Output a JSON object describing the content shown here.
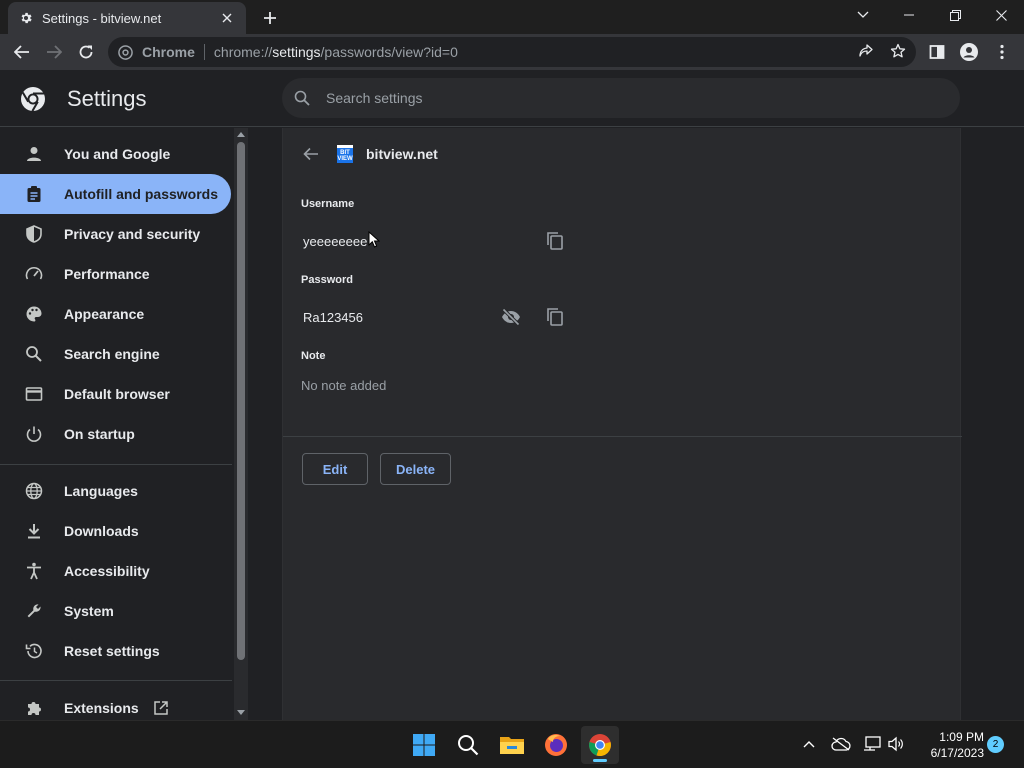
{
  "tab": {
    "title": "Settings - bitview.net",
    "icon": "gear-icon"
  },
  "omnibox": {
    "site_label": "Chrome",
    "url_prefix": "chrome://",
    "url_host": "settings",
    "url_path": "/passwords/view?id=0"
  },
  "header": {
    "title": "Settings",
    "search_placeholder": "Search settings"
  },
  "sidebar": {
    "items": [
      {
        "label": "You and Google",
        "icon": "person-icon"
      },
      {
        "label": "Autofill and passwords",
        "icon": "clipboard-icon",
        "active": true
      },
      {
        "label": "Privacy and security",
        "icon": "shield-icon"
      },
      {
        "label": "Performance",
        "icon": "speedometer-icon"
      },
      {
        "label": "Appearance",
        "icon": "palette-icon"
      },
      {
        "label": "Search engine",
        "icon": "search-icon"
      },
      {
        "label": "Default browser",
        "icon": "browser-icon"
      },
      {
        "label": "On startup",
        "icon": "power-icon"
      },
      {
        "label": "Languages",
        "icon": "globe-icon"
      },
      {
        "label": "Downloads",
        "icon": "download-icon"
      },
      {
        "label": "Accessibility",
        "icon": "accessibility-icon"
      },
      {
        "label": "System",
        "icon": "wrench-icon"
      },
      {
        "label": "Reset settings",
        "icon": "history-icon"
      },
      {
        "label": "Extensions",
        "icon": "puzzle-icon"
      }
    ]
  },
  "password_entry": {
    "site": "bitview.net",
    "site_favicon_text": [
      "BIT",
      "VIEW"
    ],
    "username_label": "Username",
    "username": "yeeeeeeee",
    "password_label": "Password",
    "password": "Ra123456",
    "note_label": "Note",
    "note": "No note added",
    "edit_label": "Edit",
    "delete_label": "Delete"
  },
  "taskbar": {
    "time": "1:09 PM",
    "date": "6/17/2023",
    "notification_count": "2",
    "apps": [
      "windows-start-icon",
      "search-icon",
      "file-explorer-icon",
      "firefox-icon",
      "chrome-icon"
    ]
  },
  "colors": {
    "accent": "#8ab4f8",
    "background": "#202124",
    "card": "#292a2d",
    "taskbar_accent": "#60cdff"
  }
}
